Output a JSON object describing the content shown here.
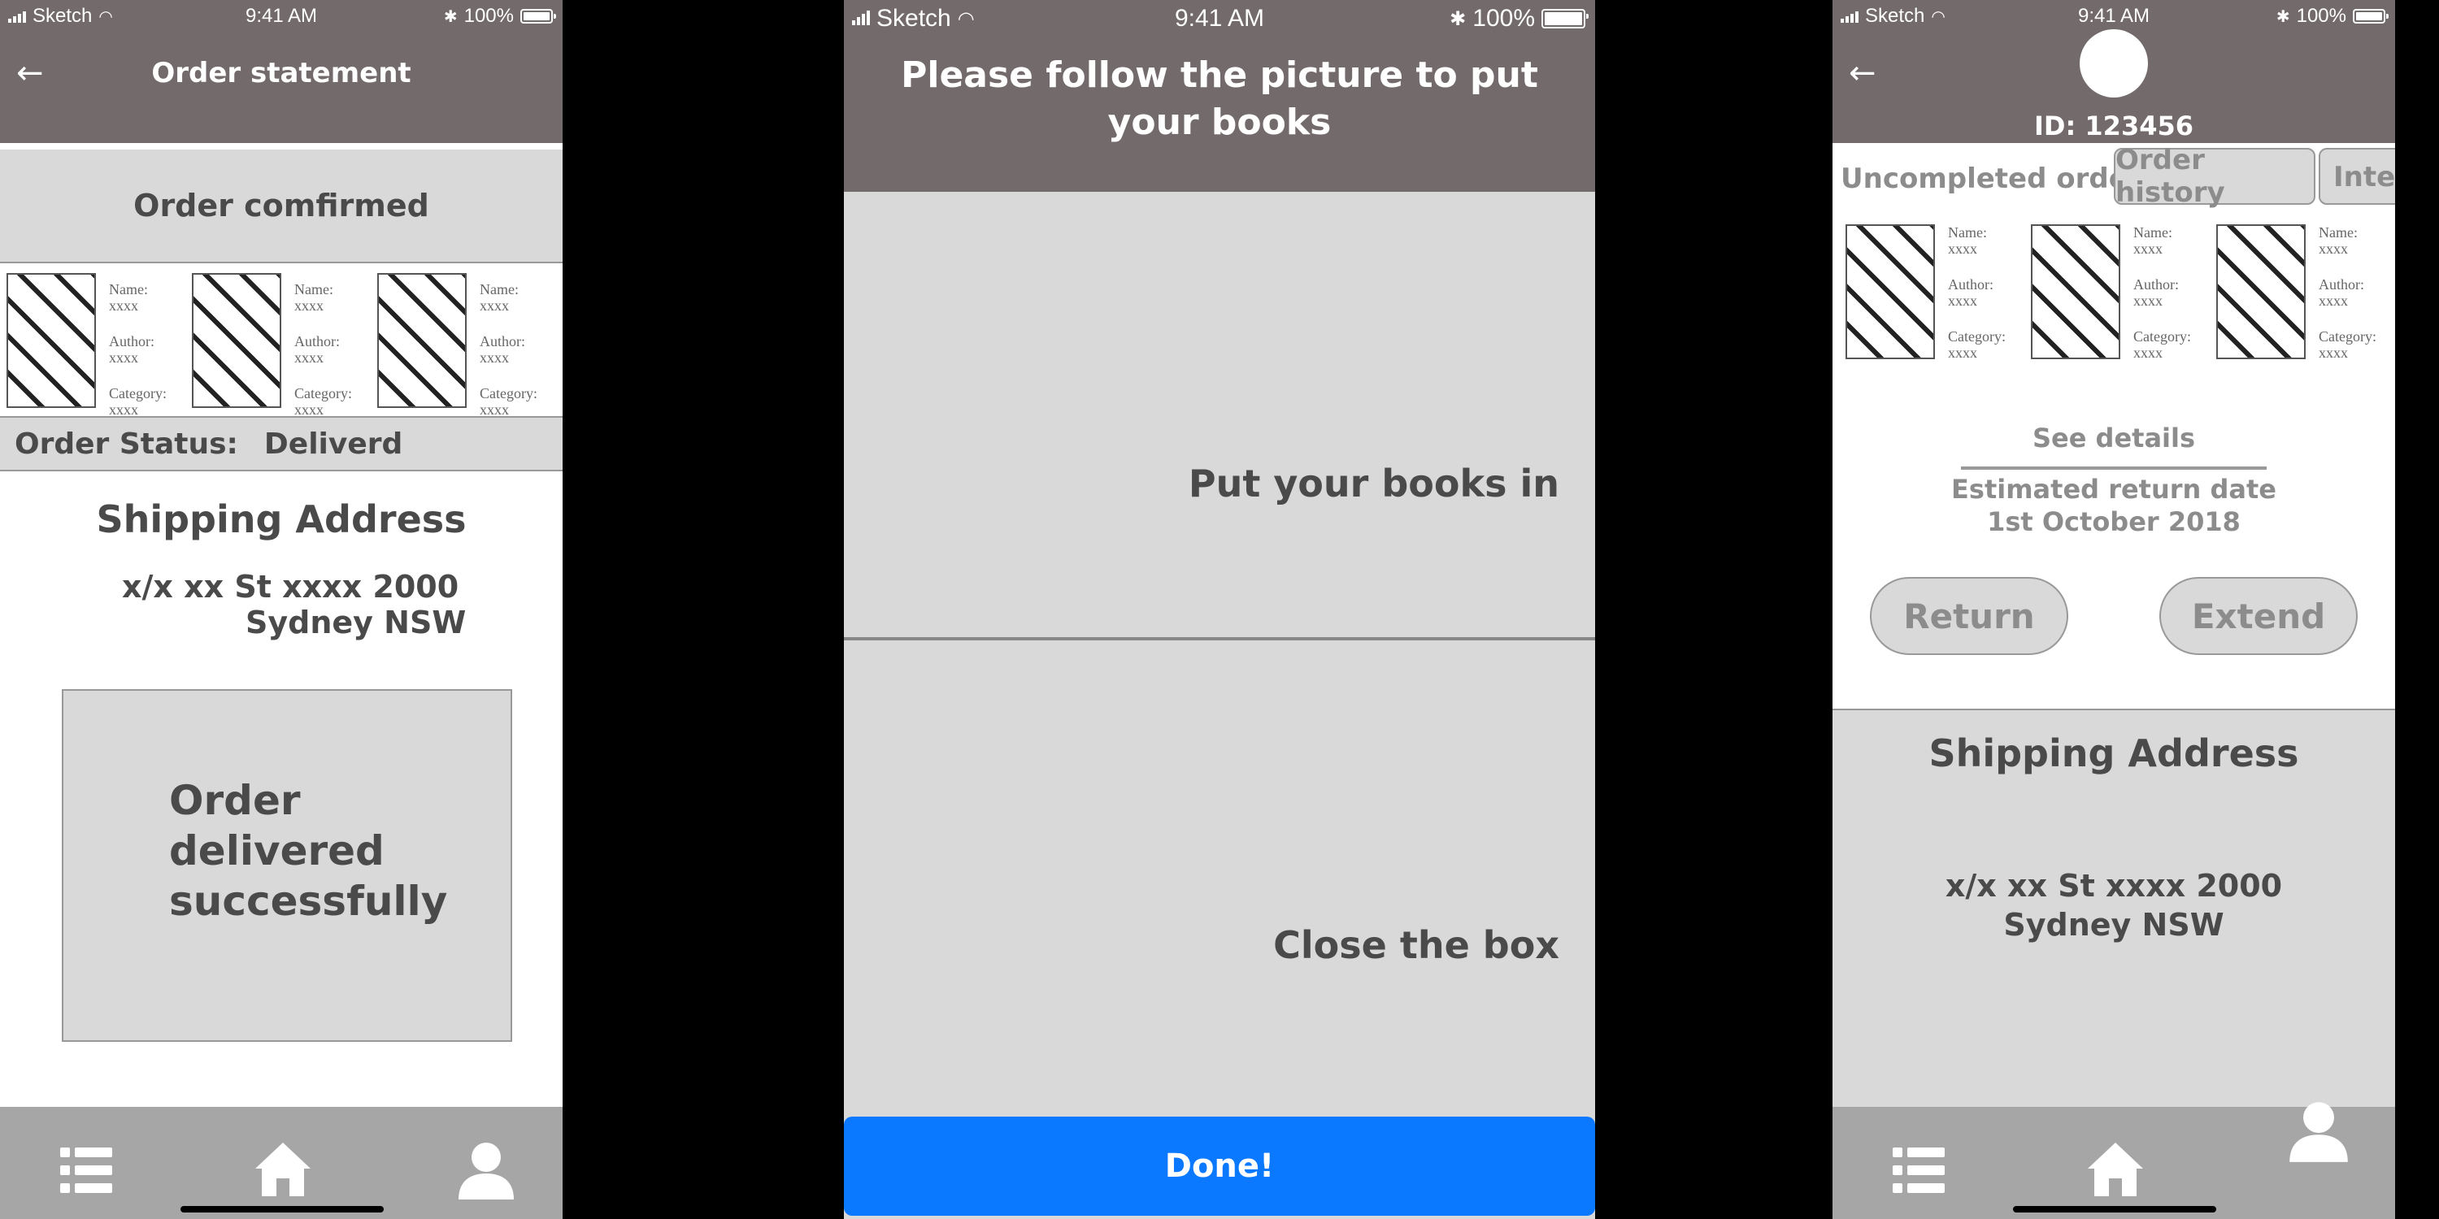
{
  "status_bar": {
    "carrier": "Sketch",
    "time": "9:41 AM",
    "battery": "100%"
  },
  "screen1": {
    "title": "Order statement",
    "order_banner": "Order comfirmed",
    "books": [
      {
        "name": "Name: xxxx",
        "author_label": "Author:",
        "author": "xxxx",
        "category_label": "Category:",
        "category": "xxxx"
      },
      {
        "name": "Name: xxxx",
        "author_label": "Author:",
        "author": "xxxx",
        "category_label": "Category:",
        "category": "xxxx"
      },
      {
        "name": "Name: xxxx",
        "author_label": "Author:",
        "author": "xxxx",
        "category_label": "Category:",
        "category": "xxxx"
      }
    ],
    "order_status_label": "Order Status:",
    "order_status_value": "Deliverd",
    "shipping_title": "Shipping Address",
    "address_line1": "x/x xx St xxxx 2000",
    "address_line2": "Sydney NSW",
    "delivered_line1": "Order",
    "delivered_line2": "delivered",
    "delivered_line3": "successfully"
  },
  "screen2": {
    "title_line1": "Please follow the picture to put",
    "title_line2": "your books",
    "step1": "Put your books in",
    "step2": "Close the box",
    "done_button": "Done!"
  },
  "screen3": {
    "user_id": "ID: 123456",
    "tabs": [
      "Uncompleted order",
      "Order history",
      "Interest"
    ],
    "books": [
      {
        "name": "Name: xxxx",
        "author_label": "Author:",
        "author": "xxxx",
        "category_label": "Category:",
        "category": "xxxx"
      },
      {
        "name": "Name: xxxx",
        "author_label": "Author:",
        "author": "xxxx",
        "category_label": "Category:",
        "category": "xxxx"
      },
      {
        "name": "Name: xxxx",
        "author_label": "Author:",
        "author": "xxxx",
        "category_label": "Category:",
        "category": "xxxx"
      }
    ],
    "see_details": "See details",
    "estimated_label": "Estimated return date",
    "estimated_date": "1st October 2018",
    "return_button": "Return",
    "extend_button": "Extend",
    "shipping_title": "Shipping Address",
    "address_line1": "x/x xx St xxxx 2000",
    "address_line2": "Sydney NSW"
  },
  "tab_bar_icons": [
    "list-icon",
    "home-icon",
    "profile-icon"
  ],
  "colors": {
    "header": "#736a6b",
    "panel": "#d9d9d9",
    "tabbar": "#a6a6a6",
    "done_button": "#0a79ff",
    "text_dark": "#4a4a4a"
  }
}
